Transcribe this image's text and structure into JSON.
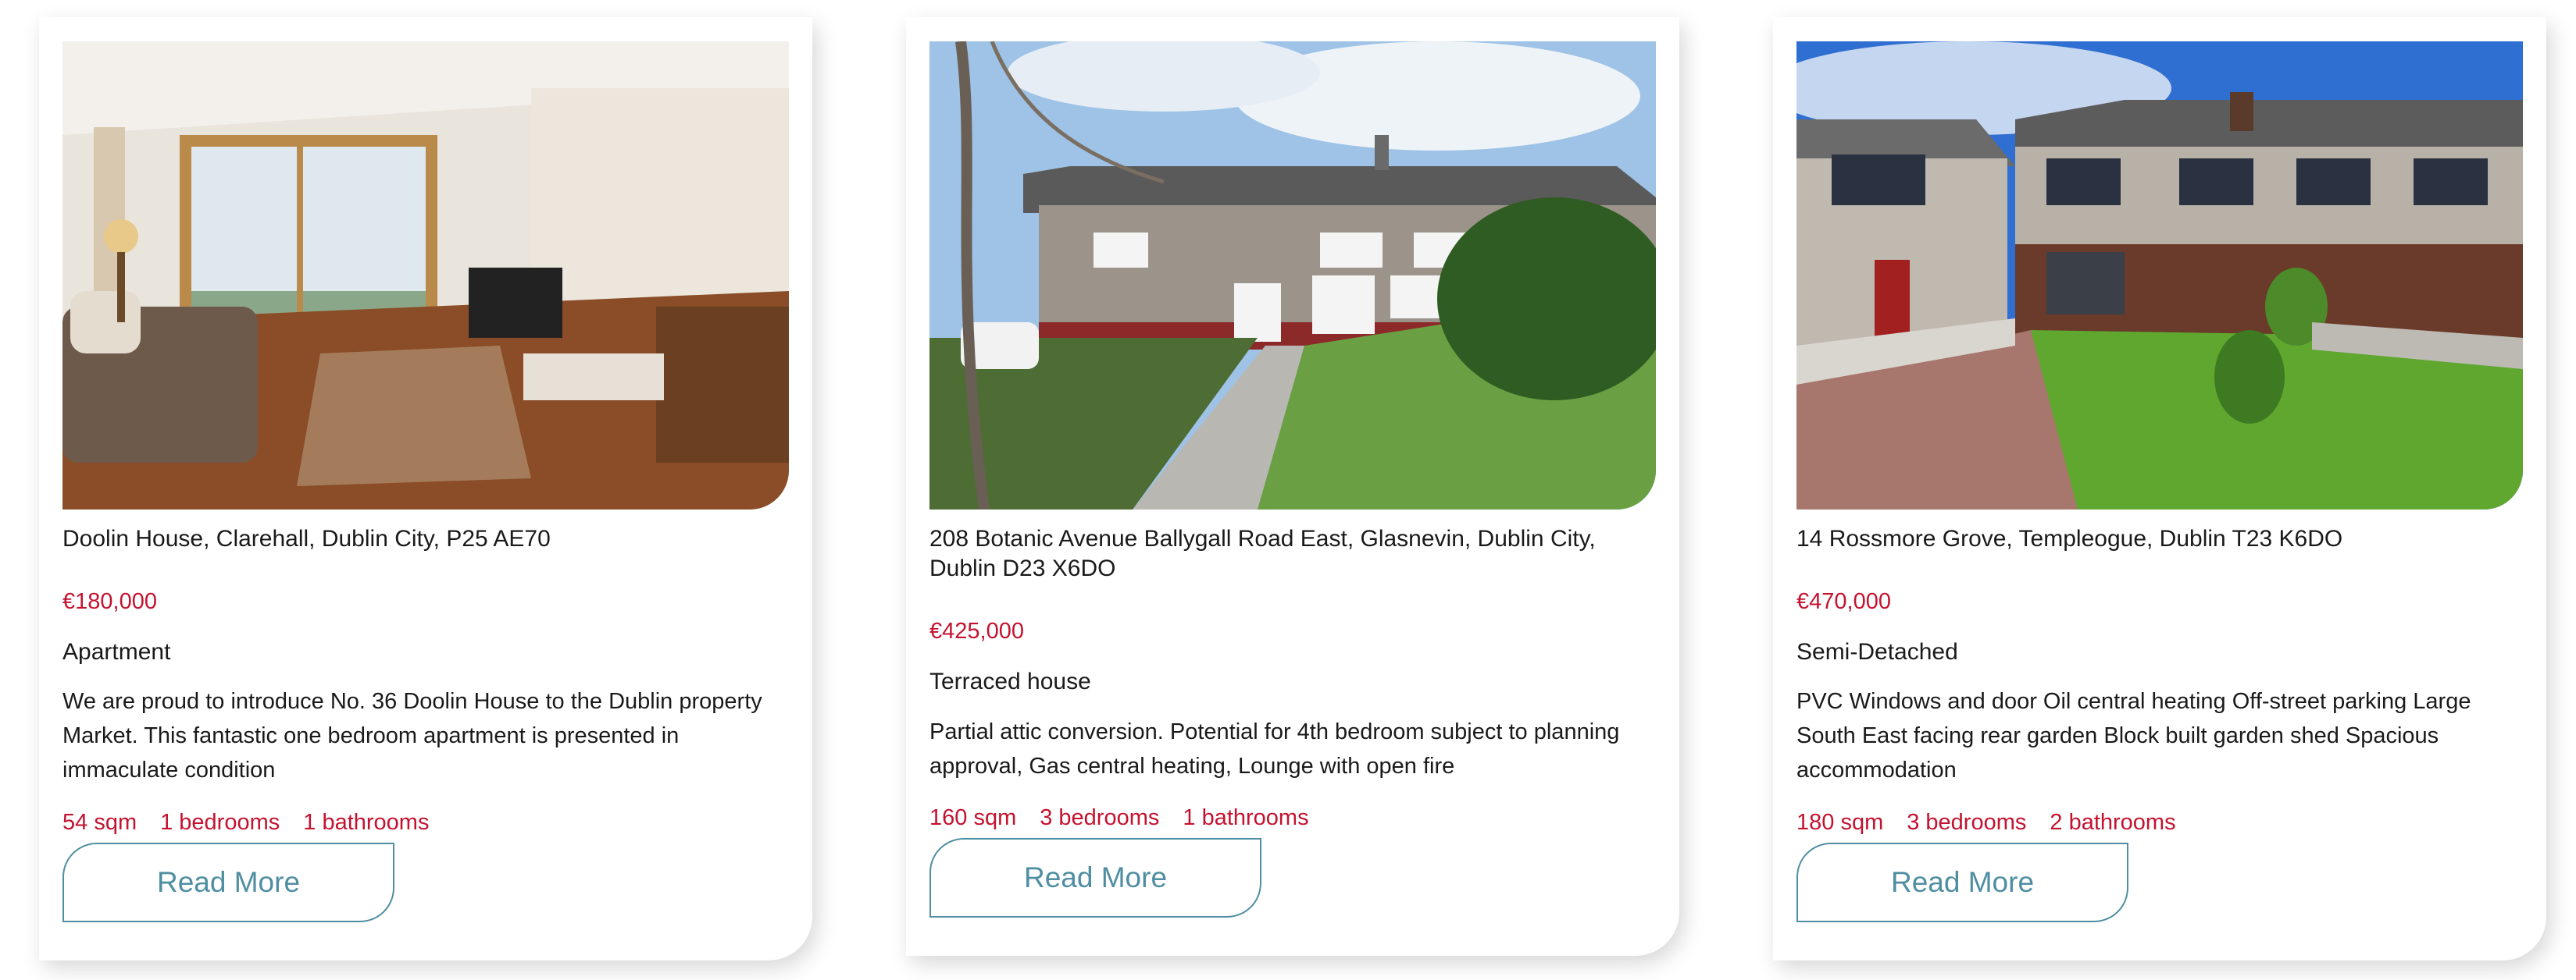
{
  "listings": [
    {
      "address": "Doolin House, Clarehall, Dublin City, P25 AE70",
      "price": "€180,000",
      "type": "Apartment",
      "description": "We are proud to introduce No. 36 Doolin House to the Dublin property Market. This fantastic one bedroom apartment is presented in immaculate condition",
      "area": "54 sqm",
      "bedrooms": "1 bedrooms",
      "bathrooms": "1 bathrooms",
      "button_label": "Read More",
      "image": "apartment-living-room-photo"
    },
    {
      "address": "208 Botanic Avenue Ballygall Road East, Glasnevin, Dublin City, Dublin D23 X6DO",
      "price": "€425,000",
      "type": "Terraced house",
      "description": "Partial attic conversion. Potential for 4th bedroom subject to planning approval, Gas central heating, Lounge with open fire",
      "area": "160 sqm",
      "bedrooms": "3 bedrooms",
      "bathrooms": "1 bathrooms",
      "button_label": "Read More",
      "image": "terraced-house-exterior-photo"
    },
    {
      "address": "14 Rossmore Grove, Templeogue, Dublin T23 K6DO",
      "price": "€470,000",
      "type": "Semi-Detached",
      "description": "PVC Windows and door Oil central heating Off-street parking Large South East facing rear garden Block built garden shed Spacious accommodation",
      "area": "180 sqm",
      "bedrooms": "3 bedrooms",
      "bathrooms": "2 bathrooms",
      "button_label": "Read More",
      "image": "semi-detached-house-exterior-photo"
    }
  ],
  "colors": {
    "price": "#c4122f",
    "accent": "#4f8ea2",
    "text": "#1a1a1a"
  }
}
